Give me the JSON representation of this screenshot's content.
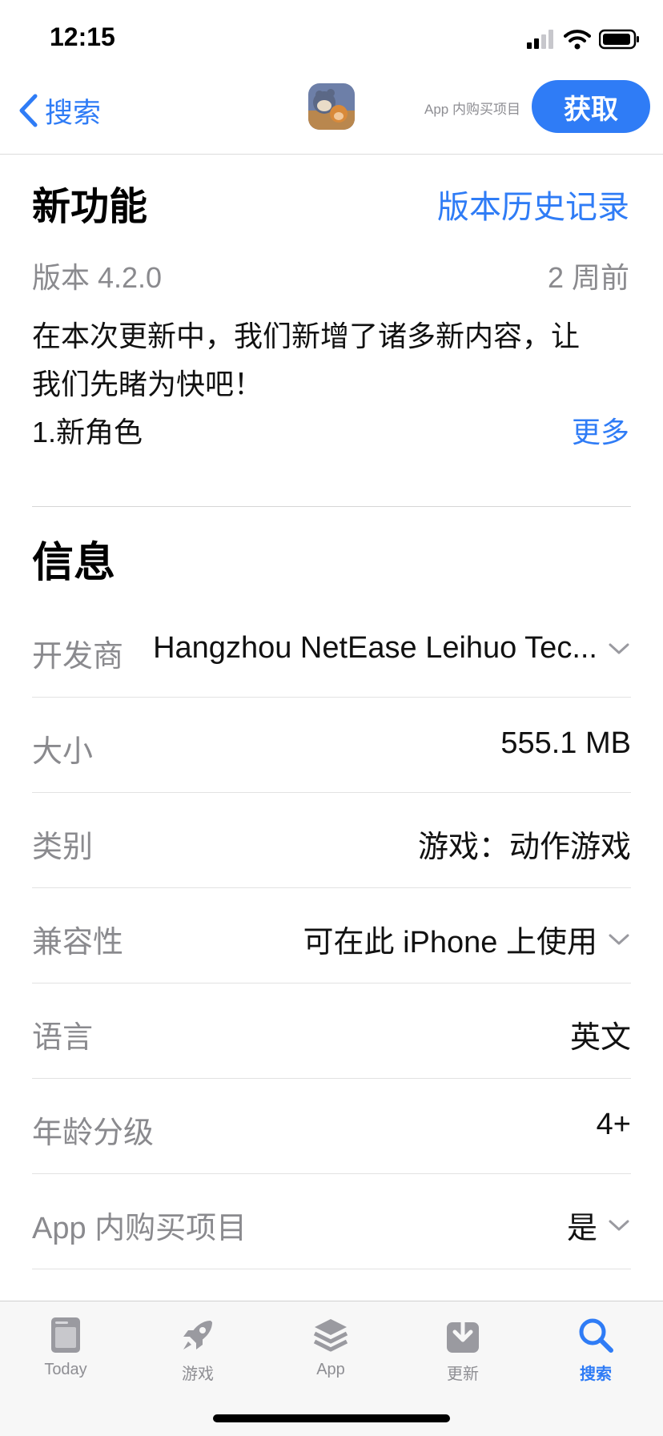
{
  "status": {
    "time": "12:15"
  },
  "nav": {
    "back_label": "搜索",
    "iap_note": "App 内购买项目",
    "get_label": "获取"
  },
  "whats_new": {
    "title": "新功能",
    "history_link": "版本历史记录",
    "version": "版本 4.2.0",
    "date": "2 周前",
    "line1": "在本次更新中，我们新增了诸多新内容，让",
    "line2": "我们先睹为快吧！",
    "line3": "1.新角色",
    "more_link": "更多"
  },
  "info": {
    "title": "信息",
    "rows": [
      {
        "label": "开发商",
        "value": "Hangzhou NetEase Leihuo Tec...",
        "chevron": true
      },
      {
        "label": "大小",
        "value": "555.1 MB",
        "chevron": false
      },
      {
        "label": "类别",
        "value": "游戏：动作游戏",
        "chevron": false
      },
      {
        "label": "兼容性",
        "value": "可在此 iPhone 上使用",
        "chevron": true
      },
      {
        "label": "语言",
        "value": "英文",
        "chevron": false
      },
      {
        "label": "年龄分级",
        "value": "4+",
        "chevron": false
      },
      {
        "label": "App 内购买项目",
        "value": "是",
        "chevron": true
      }
    ]
  },
  "tabs": [
    {
      "label": "Today",
      "icon": "today-icon",
      "active": false
    },
    {
      "label": "游戏",
      "icon": "rocket-icon",
      "active": false
    },
    {
      "label": "App",
      "icon": "apps-stack-icon",
      "active": false
    },
    {
      "label": "更新",
      "icon": "download-icon",
      "active": false
    },
    {
      "label": "搜索",
      "icon": "search-icon",
      "active": true
    }
  ],
  "colors": {
    "accent": "#2f7cf6",
    "secondary_text": "#8a8a8e"
  }
}
